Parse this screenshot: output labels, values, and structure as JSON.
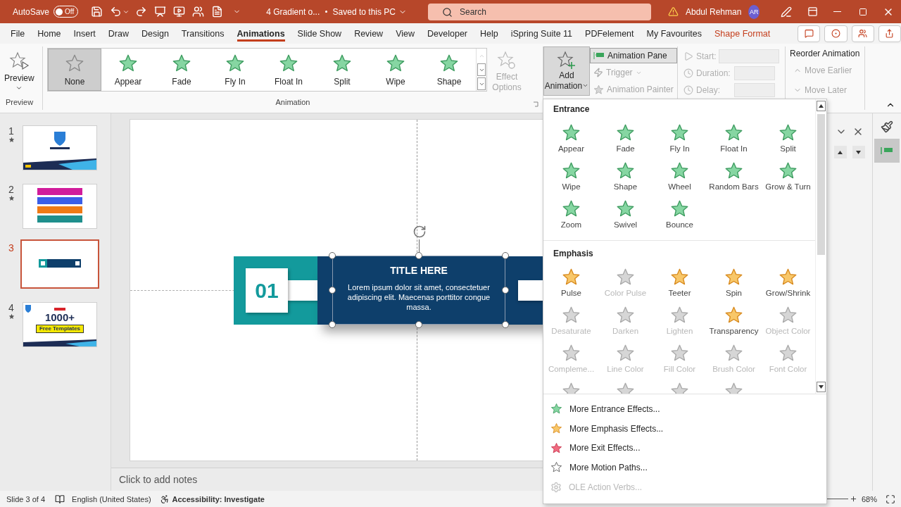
{
  "title_bar": {
    "autosave_label": "AutoSave",
    "autosave_toggle": {
      "label": "Off",
      "on": false
    },
    "document_title": "4 Gradient o...",
    "save_status": "Saved to this PC",
    "search": {
      "placeholder": "Search"
    },
    "user_name": "Abdul Rehman",
    "user_initials": "AR"
  },
  "menu_tabs": [
    {
      "label": "File",
      "kind": "normal",
      "selected": false
    },
    {
      "label": "Home",
      "kind": "normal",
      "selected": false
    },
    {
      "label": "Insert",
      "kind": "normal",
      "selected": false
    },
    {
      "label": "Draw",
      "kind": "normal",
      "selected": false
    },
    {
      "label": "Design",
      "kind": "normal",
      "selected": false
    },
    {
      "label": "Transitions",
      "kind": "normal",
      "selected": false
    },
    {
      "label": "Animations",
      "kind": "normal",
      "selected": true
    },
    {
      "label": "Slide Show",
      "kind": "normal",
      "selected": false
    },
    {
      "label": "Review",
      "kind": "normal",
      "selected": false
    },
    {
      "label": "View",
      "kind": "normal",
      "selected": false
    },
    {
      "label": "Developer",
      "kind": "normal",
      "selected": false
    },
    {
      "label": "Help",
      "kind": "normal",
      "selected": false
    },
    {
      "label": "iSpring Suite 11",
      "kind": "normal",
      "selected": false
    },
    {
      "label": "PDFelement",
      "kind": "normal",
      "selected": false
    },
    {
      "label": "My Favourites",
      "kind": "normal",
      "selected": false
    },
    {
      "label": "Shape Format",
      "kind": "contextual",
      "selected": false
    }
  ],
  "ribbon": {
    "preview": {
      "button": "Preview",
      "group_label": "Preview"
    },
    "animation_gallery": {
      "items": [
        {
          "label": "None",
          "kind": "none",
          "selected": true
        },
        {
          "label": "Appear",
          "kind": "effect",
          "selected": false
        },
        {
          "label": "Fade",
          "kind": "effect",
          "selected": false
        },
        {
          "label": "Fly In",
          "kind": "effect",
          "selected": false
        },
        {
          "label": "Float In",
          "kind": "effect",
          "selected": false
        },
        {
          "label": "Split",
          "kind": "effect",
          "selected": false
        },
        {
          "label": "Wipe",
          "kind": "effect",
          "selected": false
        },
        {
          "label": "Shape",
          "kind": "effect",
          "selected": false
        }
      ],
      "effect_options": {
        "label": "Effect Options",
        "disabled": true
      },
      "group_label": "Animation"
    },
    "advanced": {
      "add_animation": {
        "label": "Add Animation",
        "pressed": true
      },
      "commands": [
        {
          "label": "Animation Pane",
          "kind": "pane",
          "disabled": false
        },
        {
          "label": "Trigger",
          "kind": "trigger",
          "disabled": true
        },
        {
          "label": "Animation Painter",
          "kind": "painter",
          "disabled": true
        }
      ]
    },
    "timing": [
      {
        "label": "Start:",
        "kind": "combo",
        "disabled": true
      },
      {
        "label": "Duration:",
        "kind": "spin",
        "disabled": true
      },
      {
        "label": "Delay:",
        "kind": "spin",
        "disabled": true
      }
    ],
    "reorder": {
      "title": "Reorder Animation",
      "commands": [
        {
          "label": "Move Earlier",
          "kind": "up",
          "disabled": true
        },
        {
          "label": "Move Later",
          "kind": "down",
          "disabled": true
        }
      ]
    }
  },
  "slides": [
    {
      "number": "1",
      "kind": "title",
      "selected": false,
      "has_animation": true
    },
    {
      "number": "2",
      "kind": "list",
      "selected": false,
      "has_animation": true
    },
    {
      "number": "3",
      "kind": "banner",
      "selected": true,
      "has_animation": false
    },
    {
      "number": "4",
      "kind": "promo",
      "selected": false,
      "has_animation": true,
      "texts": [
        "1000+",
        "Free Templates"
      ]
    }
  ],
  "slide": {
    "number_badge": "01",
    "title": "TITLE HERE",
    "body": "Lorem ipsum dolor sit amet, consectetuer adipiscing elit. Maecenas porttitor congue massa."
  },
  "notes": {
    "prompt": "Click to add notes"
  },
  "animation_menu": {
    "sections": [
      {
        "title": "Entrance",
        "kind": "entrance",
        "items": [
          {
            "label": "Appear",
            "disabled": false
          },
          {
            "label": "Fade",
            "disabled": false
          },
          {
            "label": "Fly In",
            "disabled": false
          },
          {
            "label": "Float In",
            "disabled": false
          },
          {
            "label": "Split",
            "disabled": false
          },
          {
            "label": "Wipe",
            "disabled": false
          },
          {
            "label": "Shape",
            "disabled": false
          },
          {
            "label": "Wheel",
            "disabled": false
          },
          {
            "label": "Random Bars",
            "disabled": false
          },
          {
            "label": "Grow & Turn",
            "disabled": false
          },
          {
            "label": "Zoom",
            "disabled": false
          },
          {
            "label": "Swivel",
            "disabled": false
          },
          {
            "label": "Bounce",
            "disabled": false
          }
        ]
      },
      {
        "title": "Emphasis",
        "kind": "emphasis",
        "items": [
          {
            "label": "Pulse",
            "disabled": false
          },
          {
            "label": "Color Pulse",
            "disabled": true
          },
          {
            "label": "Teeter",
            "disabled": false
          },
          {
            "label": "Spin",
            "disabled": false
          },
          {
            "label": "Grow/Shrink",
            "disabled": false
          },
          {
            "label": "Desaturate",
            "disabled": true
          },
          {
            "label": "Darken",
            "disabled": true
          },
          {
            "label": "Lighten",
            "disabled": true
          },
          {
            "label": "Transparency",
            "disabled": false
          },
          {
            "label": "Object Color",
            "disabled": true
          },
          {
            "label": "Compleme...",
            "disabled": true
          },
          {
            "label": "Line Color",
            "disabled": true
          },
          {
            "label": "Fill Color",
            "disabled": true
          },
          {
            "label": "Brush Color",
            "disabled": true
          },
          {
            "label": "Font Color",
            "disabled": true
          }
        ],
        "partial_icons": [
          {
            "kind": "star"
          },
          {
            "kind": "star"
          },
          {
            "kind": "star"
          },
          {
            "kind": "star"
          }
        ]
      }
    ],
    "commands": [
      {
        "label": "More Entrance Effects...",
        "kind": "entrance",
        "disabled": false
      },
      {
        "label": "More Emphasis Effects...",
        "kind": "emphasis",
        "disabled": false
      },
      {
        "label": "More Exit Effects...",
        "kind": "exit",
        "disabled": false
      },
      {
        "label": "More Motion Paths...",
        "kind": "motion",
        "disabled": false
      },
      {
        "label": "OLE Action Verbs...",
        "kind": "ole",
        "disabled": true
      }
    ]
  },
  "status_bar": {
    "slide_position": "Slide 3 of 4",
    "language": "English (United States)",
    "accessibility": "Accessibility: Investigate",
    "zoom": "68%"
  }
}
